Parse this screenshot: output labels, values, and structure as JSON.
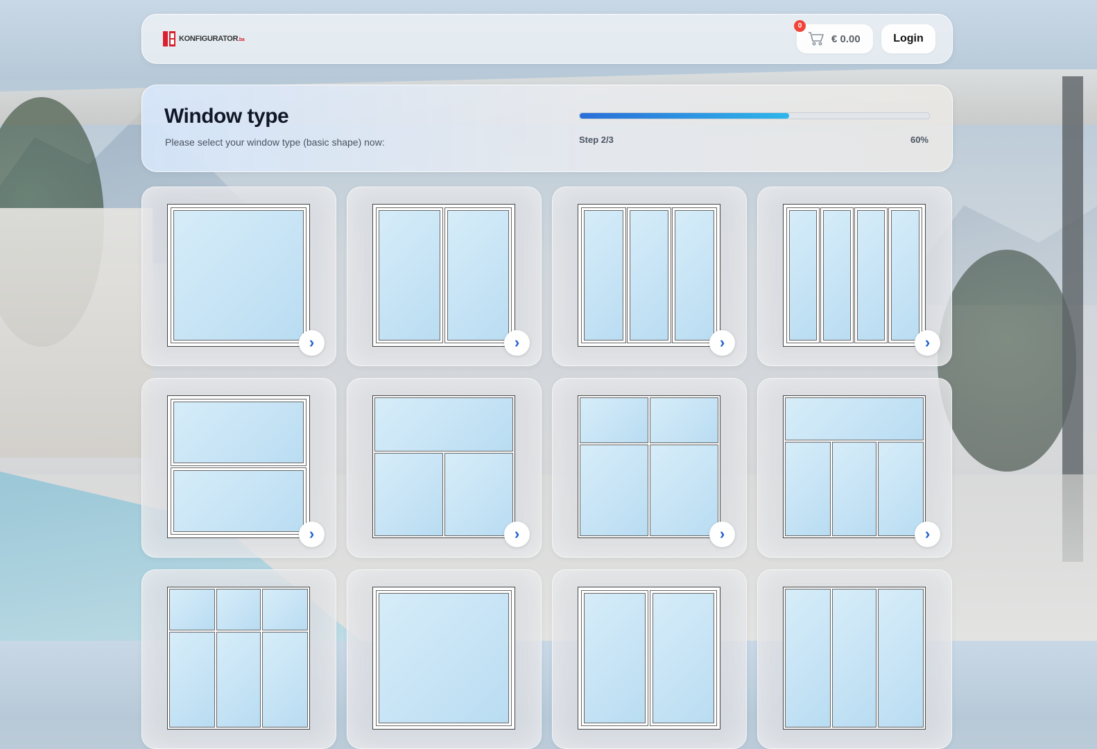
{
  "header": {
    "logo_name": "KONFIGURATOR",
    "logo_tld": ".ba",
    "cart_count": "0",
    "cart_total": "€ 0.00",
    "login_label": "Login"
  },
  "step": {
    "title": "Window type",
    "subtitle": "Please select your window type (basic shape) now:",
    "step_label": "Step 2/3",
    "percent_label": "60%",
    "progress": 0.6
  },
  "window_types": [
    {
      "id": "single"
    },
    {
      "id": "double-vertical"
    },
    {
      "id": "triple-vertical"
    },
    {
      "id": "quad-vertical"
    },
    {
      "id": "double-horizontal"
    },
    {
      "id": "top-light-two-bottom"
    },
    {
      "id": "two-top-two-bottom"
    },
    {
      "id": "top-light-three-bottom"
    },
    {
      "id": "grid-3x2"
    },
    {
      "id": "single-partial"
    },
    {
      "id": "two-partial"
    },
    {
      "id": "three-partial"
    }
  ],
  "icons": {
    "cart": "cart-icon",
    "next": "chevron-right-icon"
  },
  "colors": {
    "brand_red": "#d8202e",
    "accent_blue": "#1f5fd1",
    "badge_red": "#f04438"
  }
}
